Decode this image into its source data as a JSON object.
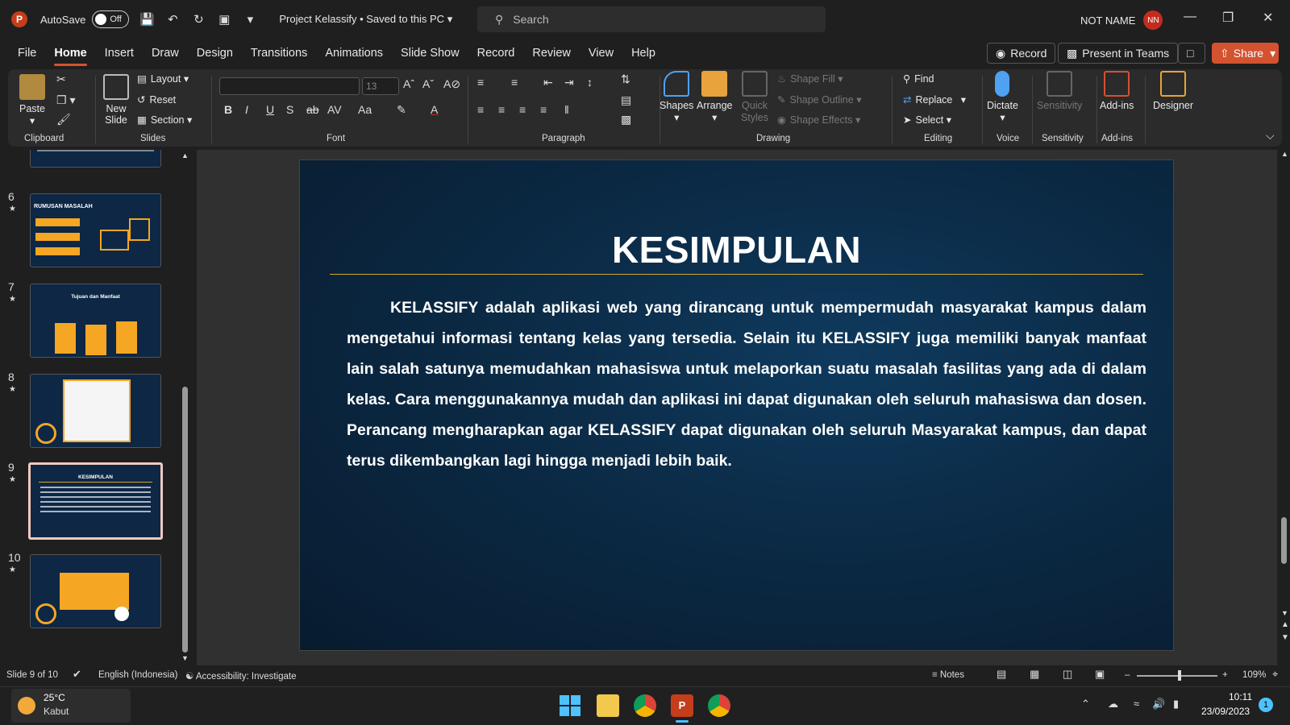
{
  "titlebar": {
    "autosave_label": "AutoSave",
    "autosave_state": "Off",
    "doc_title": "Project Kelassify • Saved to this PC",
    "search_placeholder": "Search",
    "user_name": "NOT NAME",
    "user_initials": "NN"
  },
  "menu": {
    "tabs": [
      "File",
      "Home",
      "Insert",
      "Draw",
      "Design",
      "Transitions",
      "Animations",
      "Slide Show",
      "Record",
      "Review",
      "View",
      "Help"
    ],
    "active": "Home",
    "record_label": "Record",
    "present_label": "Present in Teams",
    "share_label": "Share"
  },
  "ribbon": {
    "clipboard": {
      "paste": "Paste",
      "label": "Clipboard"
    },
    "slides": {
      "new_slide": "New Slide",
      "layout": "Layout",
      "reset": "Reset",
      "section": "Section",
      "label": "Slides"
    },
    "font": {
      "size": "13",
      "label": "Font"
    },
    "paragraph": {
      "label": "Paragraph"
    },
    "drawing": {
      "shapes": "Shapes",
      "arrange": "Arrange",
      "quick_styles": "Quick Styles",
      "shape_fill": "Shape Fill",
      "shape_outline": "Shape Outline",
      "shape_effects": "Shape Effects",
      "label": "Drawing"
    },
    "editing": {
      "find": "Find",
      "replace": "Replace",
      "select": "Select",
      "label": "Editing"
    },
    "voice": {
      "dictate": "Dictate",
      "label": "Voice"
    },
    "sensitivity": {
      "btn": "Sensitivity",
      "label": "Sensitivity"
    },
    "addins": {
      "btn": "Add-ins",
      "label": "Add-ins"
    },
    "designer": {
      "btn": "Designer"
    }
  },
  "slides_pane": {
    "thumbs": [
      {
        "number": "6",
        "title": "RUMUSAN MASALAH"
      },
      {
        "number": "7",
        "title": "Tujuan dan Manfaat"
      },
      {
        "number": "8",
        "title": ""
      },
      {
        "number": "9",
        "title": "KESIMPULAN"
      },
      {
        "number": "10",
        "title": ""
      }
    ],
    "star": "★",
    "selected_index": 3
  },
  "slide": {
    "title": "KESIMPULAN",
    "body": "KELASSIFY adalah aplikasi web yang dirancang untuk mempermudah masyarakat kampus dalam mengetahui informasi tentang kelas yang tersedia. Selain itu KELASSIFY juga memiliki banyak manfaat lain salah satunya memudahkan mahasiswa untuk melaporkan suatu masalah fasilitas yang ada di dalam kelas. Cara menggunakannya mudah dan aplikasi ini dapat digunakan oleh seluruh mahasiswa dan dosen. Perancang mengharapkan agar KELASSIFY dapat digunakan oleh seluruh Masyarakat kampus, dan dapat terus dikembangkan lagi hingga menjadi lebih baik."
  },
  "statusbar": {
    "slide_counter": "Slide 9 of 10",
    "language": "English (Indonesia)",
    "accessibility": "Accessibility: Investigate",
    "notes": "Notes",
    "zoom": "109%"
  },
  "taskbar": {
    "temp": "25°C",
    "weather": "Kabut",
    "time": "10:11",
    "date": "23/09/2023",
    "notif_count": "1"
  },
  "colors": {
    "accent": "#d35230",
    "slide_bg": "#0b2a45",
    "rule": "#d4a72c"
  }
}
